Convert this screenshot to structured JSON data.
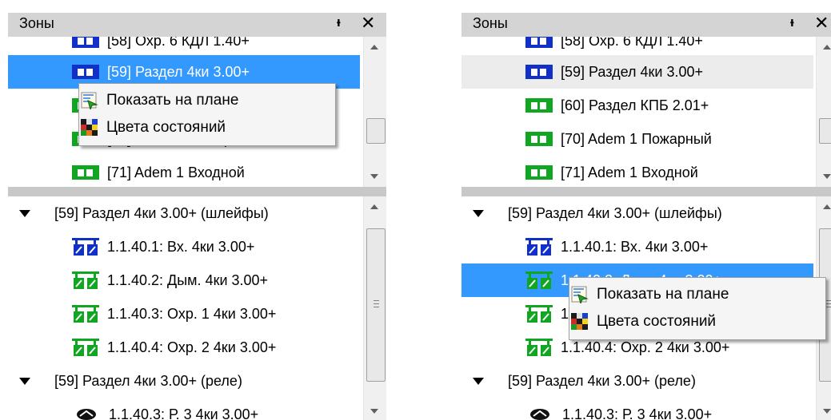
{
  "panel": {
    "title": "Зоны",
    "pin_glyph": "ᵻ",
    "close_glyph": "✕"
  },
  "zones": [
    {
      "label": "[58] Охр. 6 КДЛ 1.40+",
      "icon": "zone-icon",
      "color": "blue"
    },
    {
      "label": "[59] Раздел 4ки 3.00+",
      "icon": "zone-icon",
      "color": "blue"
    },
    {
      "label": "[60] Раздел КПБ 2.01+",
      "icon": "zone-icon",
      "color": "green"
    },
    {
      "label": "[70] Adem 1 Пожарный",
      "icon": "zone-icon",
      "color": "green"
    },
    {
      "label": "[71] Adem 1 Входной",
      "icon": "zone-icon",
      "color": "green"
    }
  ],
  "devices": {
    "group_loops": "[59] Раздел 4ки 3.00+ (шлейфы)",
    "loops": [
      {
        "label": "1.1.40.1: Вх. 4ки 3.00+",
        "color": "blue"
      },
      {
        "label": "1.1.40.2: Дым. 4ки 3.00+",
        "color": "green"
      },
      {
        "label": "1.1.40.3: Охр. 1 4ки 3.00+",
        "color": "green"
      },
      {
        "label": "1.1.40.4: Охр. 2 4ки 3.00+",
        "color": "green"
      }
    ],
    "group_relays": "[59] Раздел 4ки 3.00+ (реле)",
    "relays": [
      {
        "label": "1.1.40.3: Р. 3 4ки 3.00+"
      }
    ]
  },
  "context_menu": {
    "items": [
      {
        "label": "Показать на плане",
        "icon": "show-on-plan-icon"
      },
      {
        "label": "Цвета состояний",
        "icon": "state-colors-icon"
      }
    ]
  },
  "colors": {
    "selection": "#3399ff",
    "zone_green": "#11a622",
    "zone_blue": "#1030c8"
  }
}
